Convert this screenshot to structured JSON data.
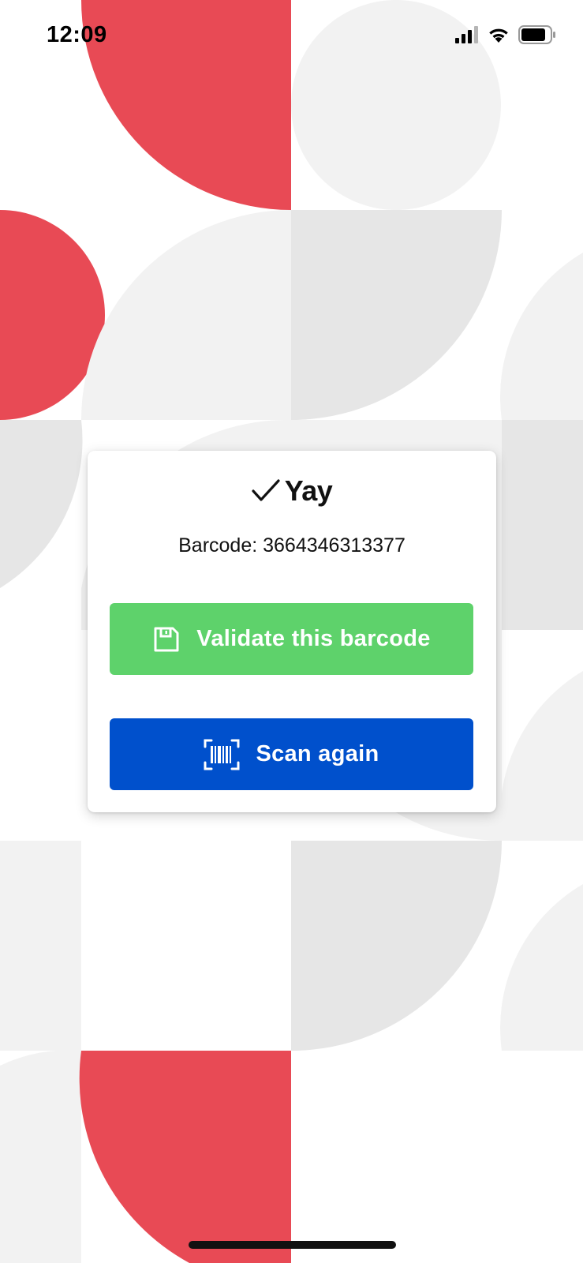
{
  "status_bar": {
    "time": "12:09",
    "signal_icon": "cellular-signal-icon",
    "wifi_icon": "wifi-icon",
    "battery_icon": "battery-icon"
  },
  "dialog": {
    "title_icon": "checkmark-icon",
    "title": "Yay",
    "barcode_text": "Barcode: 3664346313377"
  },
  "buttons": {
    "validate": {
      "icon": "floppy-disk-icon",
      "label": "Validate this barcode",
      "color": "#5ed26b"
    },
    "scan": {
      "icon": "barcode-scan-icon",
      "label": "Scan again",
      "color": "#0050cc"
    }
  },
  "colors": {
    "accent_red": "#e84a55",
    "light_gray": "#f2f2f2",
    "mid_gray": "#e6e6e6"
  }
}
